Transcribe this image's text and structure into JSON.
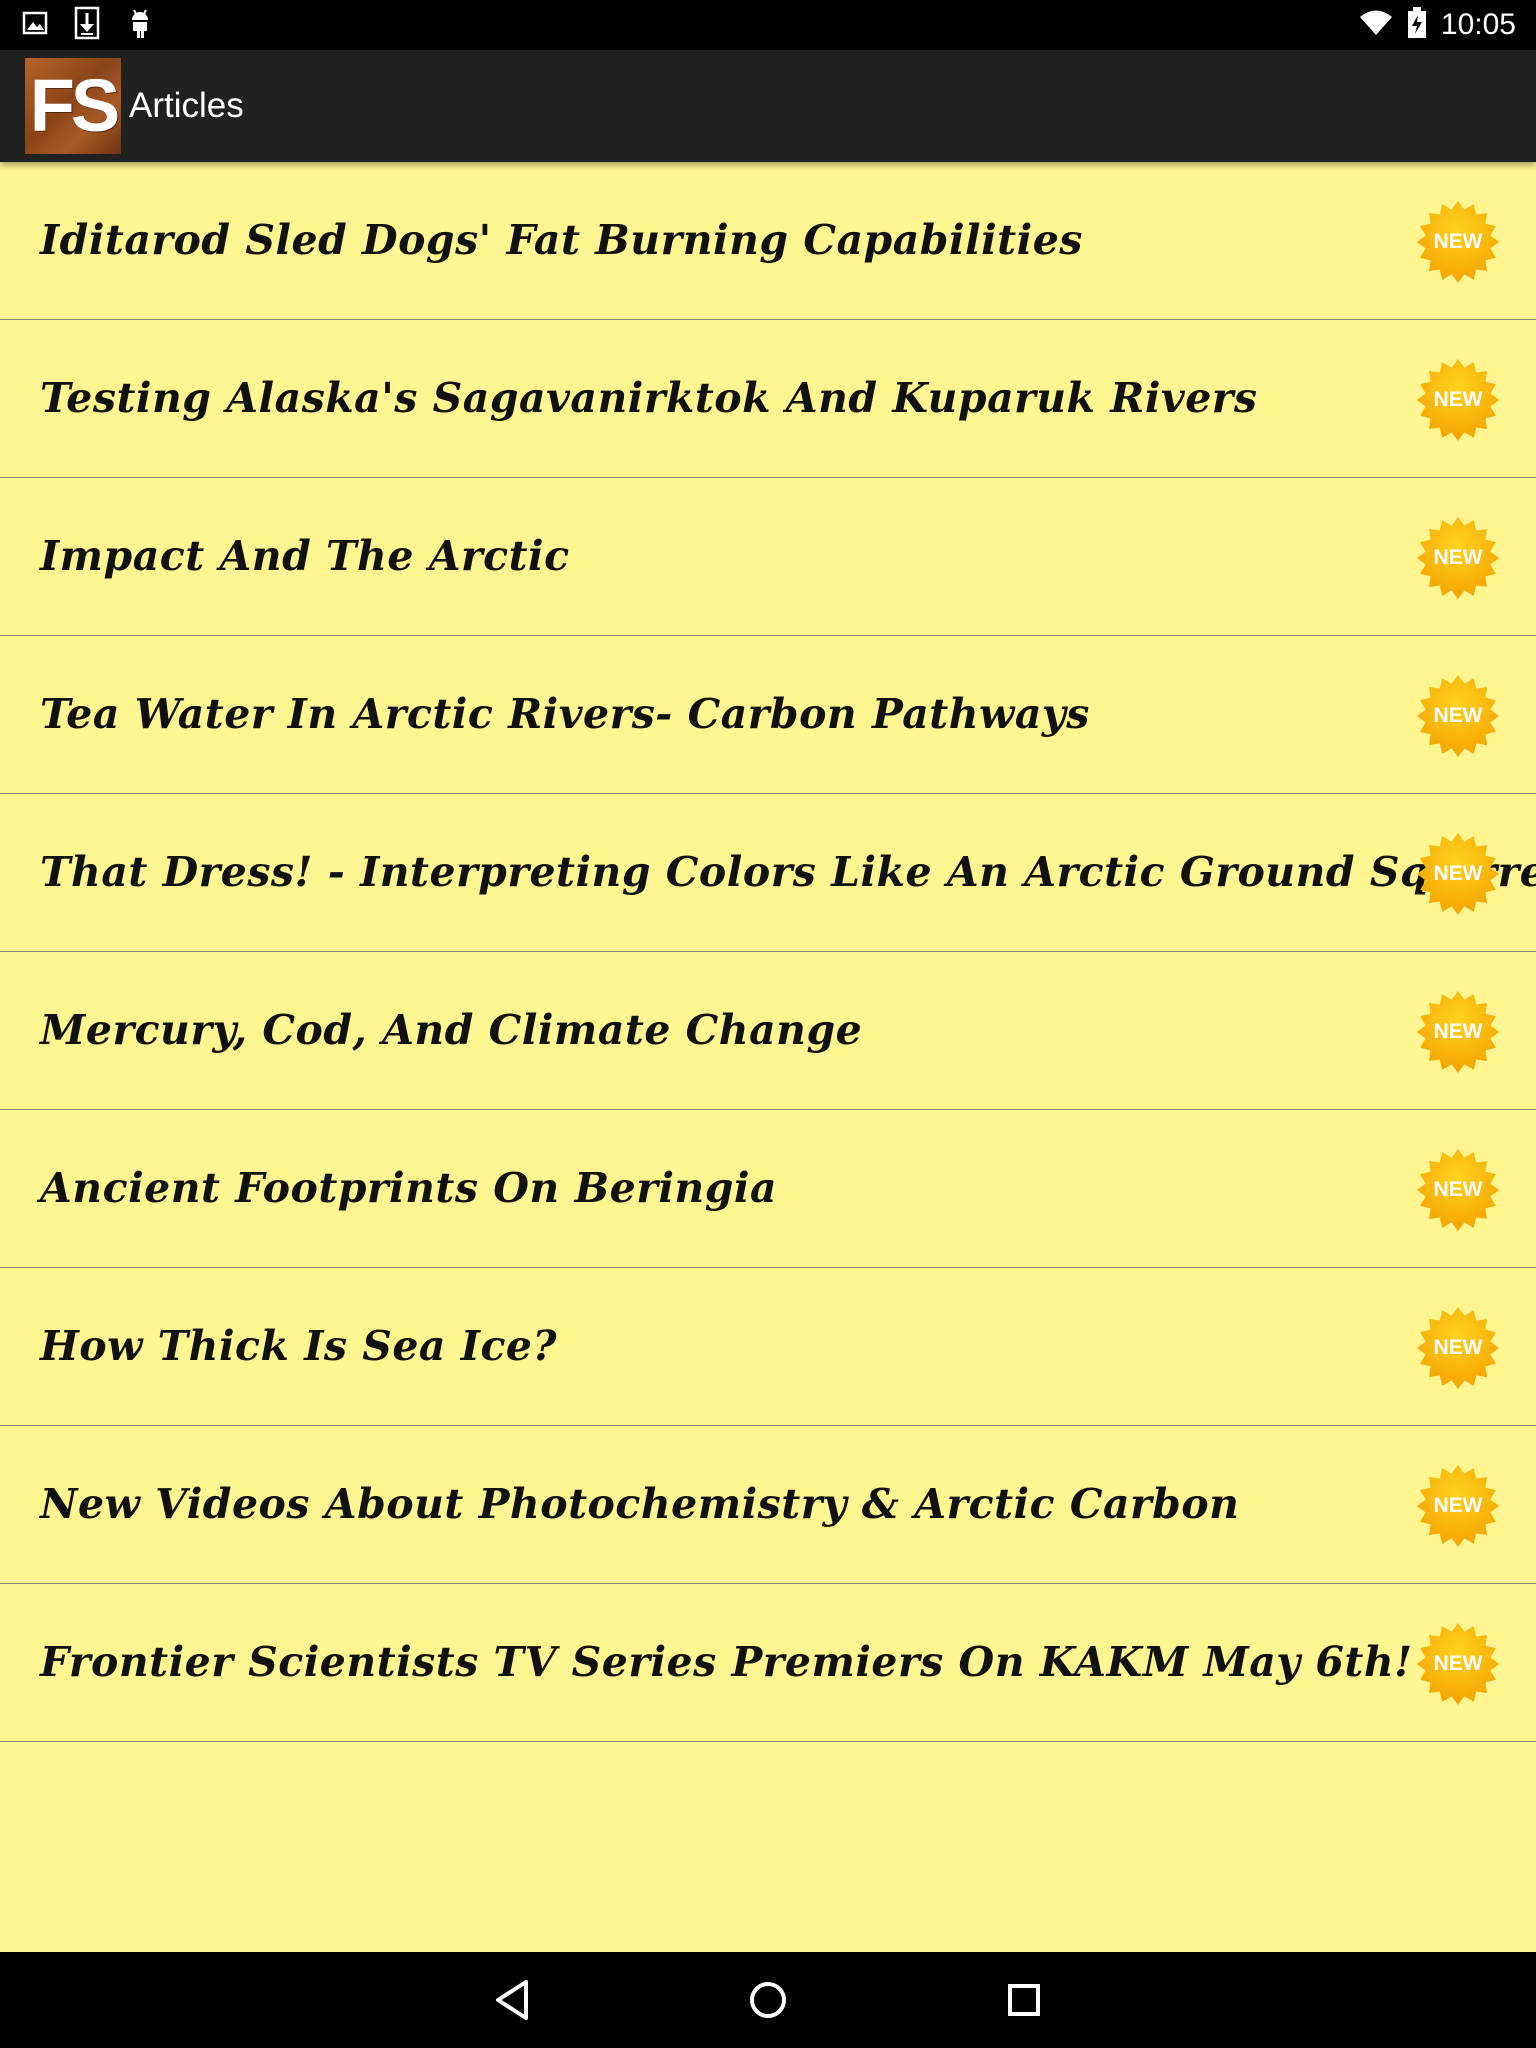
{
  "status_bar": {
    "time": "10:05",
    "left_icons": [
      "image-icon",
      "download-icon",
      "android-icon"
    ],
    "right_icons": [
      "wifi-icon",
      "battery-charging-icon"
    ]
  },
  "action_bar": {
    "logo_text": "FS",
    "title": "Articles"
  },
  "articles": [
    {
      "title": "Iditarod Sled Dogs' Fat Burning Capabilities",
      "badge": "NEW"
    },
    {
      "title": "Testing Alaska's Sagavanirktok And Kuparuk Rivers",
      "badge": "NEW"
    },
    {
      "title": "Impact And The Arctic",
      "badge": "NEW"
    },
    {
      "title": "Tea Water In Arctic Rivers- Carbon Pathways",
      "badge": "NEW"
    },
    {
      "title": "That Dress! - Interpreting Colors Like An Arctic Ground Squirrel",
      "badge": "NEW"
    },
    {
      "title": "Mercury, Cod, And Climate Change",
      "badge": "NEW"
    },
    {
      "title": "Ancient Footprints On Beringia",
      "badge": "NEW"
    },
    {
      "title": "How Thick Is Sea Ice?",
      "badge": "NEW"
    },
    {
      "title": "New Videos About Photochemistry & Arctic Carbon",
      "badge": "NEW"
    },
    {
      "title": "Frontier Scientists TV Series Premiers On KAKM May 6th!",
      "badge": "NEW"
    }
  ],
  "nav_bar": {
    "buttons": [
      "back-icon",
      "home-icon",
      "recents-icon"
    ]
  },
  "colors": {
    "list_background": "#fff591",
    "action_bar": "#212121",
    "badge_orange": "#f5a400",
    "badge_yellow": "#ffd21f"
  }
}
